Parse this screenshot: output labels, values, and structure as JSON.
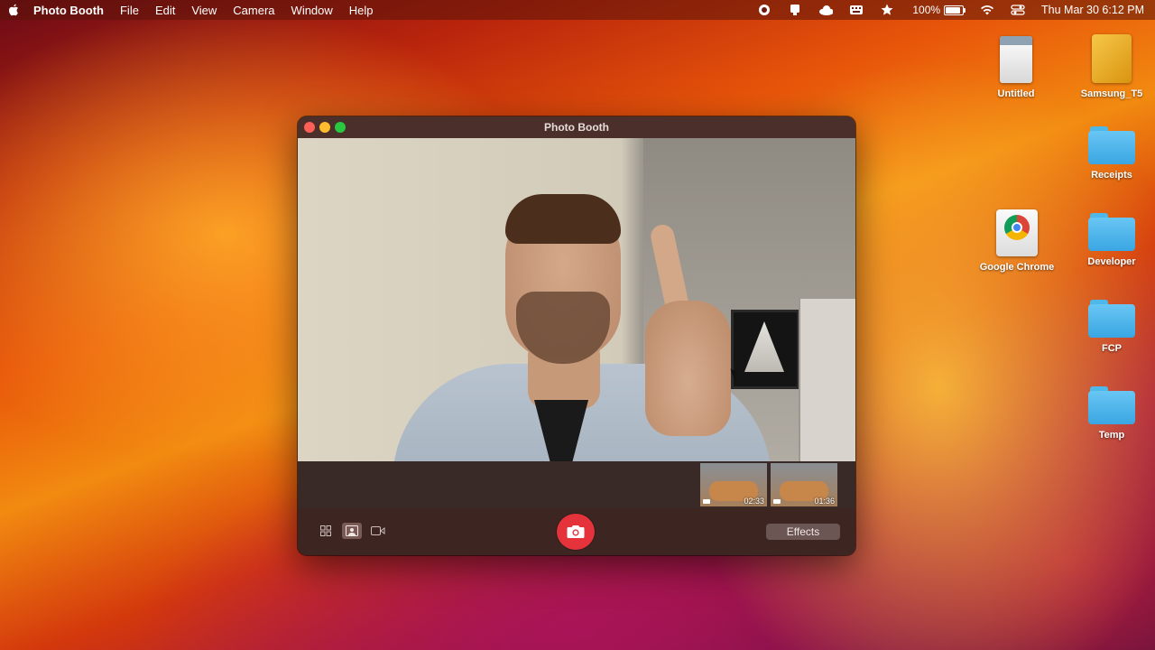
{
  "menubar": {
    "app_name": "Photo Booth",
    "menus": [
      "File",
      "Edit",
      "View",
      "Camera",
      "Window",
      "Help"
    ],
    "battery_percent": "100%",
    "battery_level": 1.0,
    "clock": "Thu Mar 30  6:12 PM",
    "status_icons": [
      "record-icon",
      "hardware-icon",
      "cloud-icon",
      "keyboard-icon",
      "star-icon",
      "wifi-icon",
      "control-center-icon"
    ]
  },
  "desktop": {
    "icons": [
      {
        "label": "Untitled",
        "kind": "drive-white"
      },
      {
        "label": "Samsung_T5",
        "kind": "drive-gold"
      },
      {
        "label": "Receipts",
        "kind": "folder"
      },
      {
        "label": "Google Chrome",
        "kind": "app"
      },
      {
        "label": "Developer",
        "kind": "folder"
      },
      {
        "label": "FCP",
        "kind": "folder"
      },
      {
        "label": "Temp",
        "kind": "folder"
      }
    ]
  },
  "window": {
    "title": "Photo Booth",
    "thumbnails": [
      {
        "duration": "02:33"
      },
      {
        "duration": "01:36"
      }
    ],
    "effects_label": "Effects"
  },
  "colors": {
    "shutter": "#e4333b",
    "folder": "#4fb8ea"
  }
}
